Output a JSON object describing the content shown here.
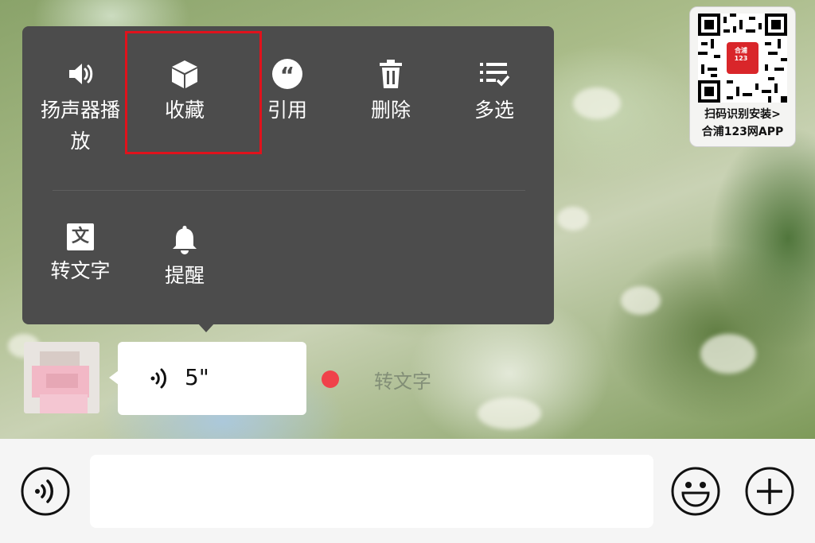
{
  "menu": {
    "row1": [
      {
        "label": "扬声器播\n放",
        "icon": "speaker-icon"
      },
      {
        "label": "收藏",
        "icon": "cube-icon"
      },
      {
        "label": "引用",
        "icon": "quote-icon"
      },
      {
        "label": "删除",
        "icon": "trash-icon"
      },
      {
        "label": "多选",
        "icon": "multiselect-icon"
      }
    ],
    "row2": [
      {
        "label": "转文字",
        "icon": "text-icon",
        "glyph": "文"
      },
      {
        "label": "提醒",
        "icon": "bell-icon"
      }
    ],
    "highlighted": "收藏"
  },
  "qr_badge": {
    "logo_text": "合浦 123",
    "line1": "扫码识别安装>",
    "line2": "合浦123网APP"
  },
  "message": {
    "duration": "5\"",
    "convert_hint": "转文字"
  },
  "input_bar": {
    "placeholder": ""
  },
  "colors": {
    "menu_bg": "#4c4c4c",
    "highlight": "#e0121c",
    "unread_dot": "#f0424a"
  }
}
